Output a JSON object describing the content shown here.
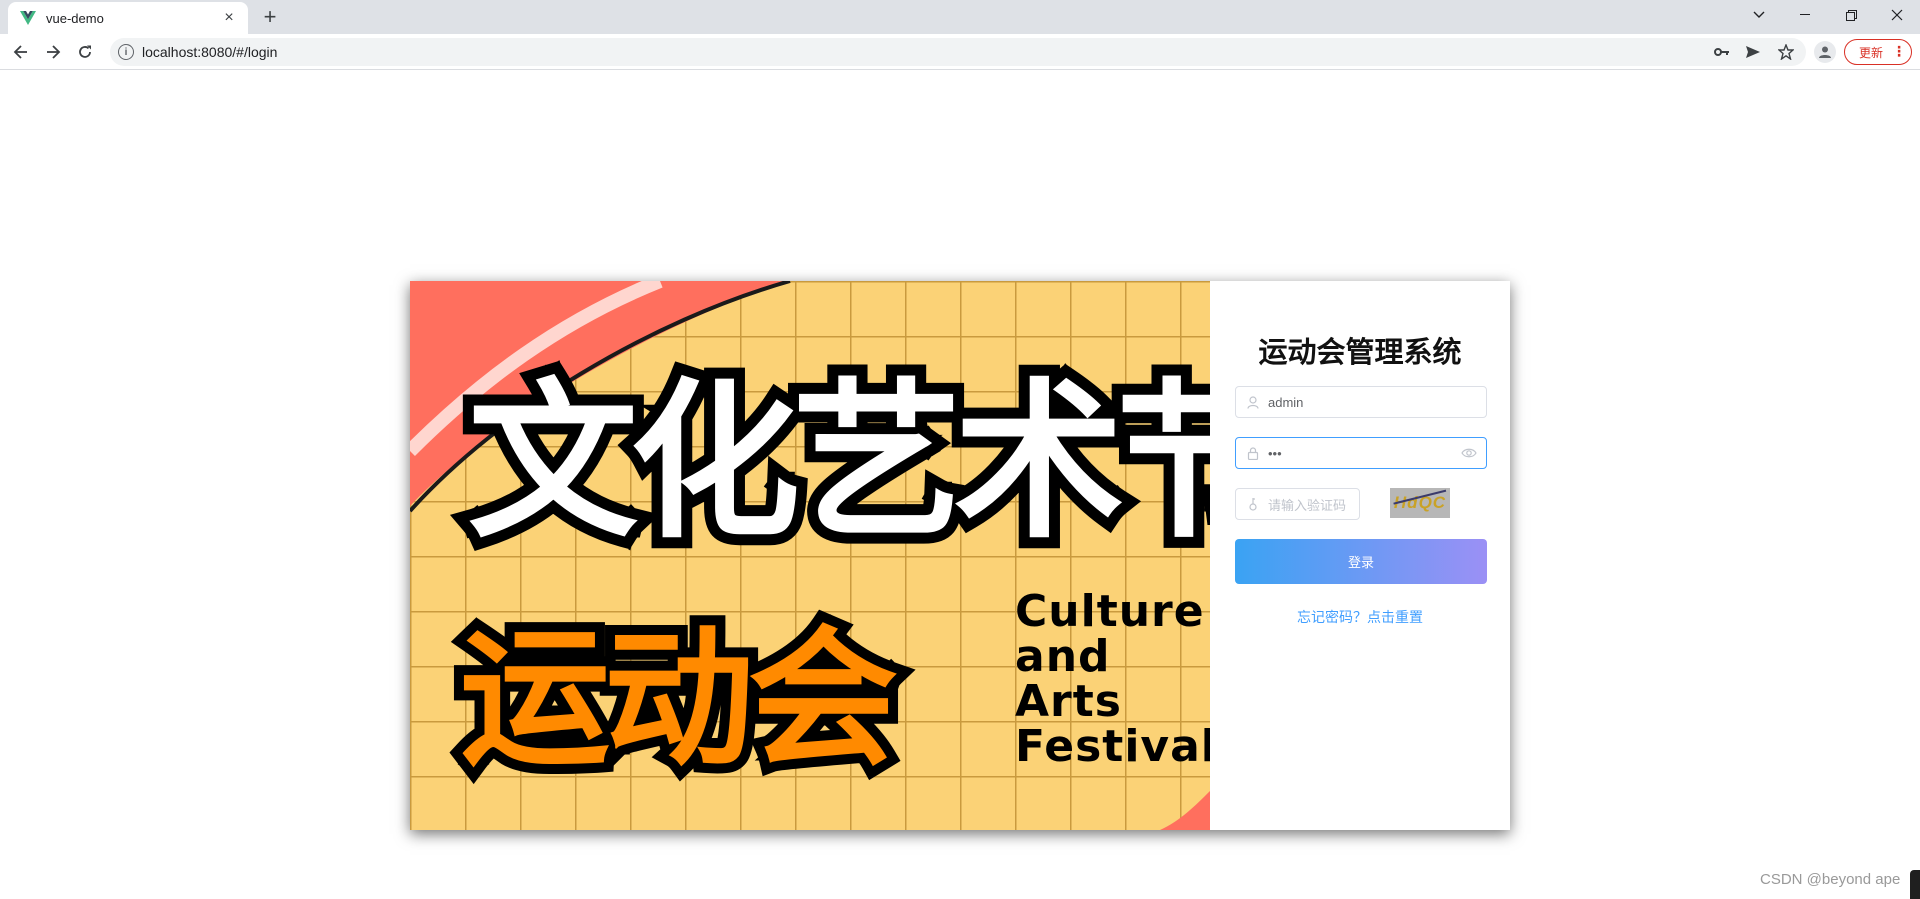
{
  "browser": {
    "tab_title": "vue-demo",
    "tab_close": "×",
    "new_tab": "+",
    "url": "localhost:8080/#/login",
    "update_label": "更新",
    "update_menu": "⋮",
    "window_controls": {
      "tab_search": "⌄",
      "minimize": "—",
      "restore": "❐",
      "close": "✕"
    }
  },
  "banner": {
    "headline": "文化艺术节",
    "subheadline": "运动会",
    "english": [
      "Culture",
      "and",
      "Arts",
      "Festival"
    ]
  },
  "login": {
    "title": "运动会管理系统",
    "username_value": "admin",
    "password_value": "•••",
    "captcha_placeholder": "请输入验证码",
    "captcha_text": "HdQC",
    "login_button": "登录",
    "forgot_link": "忘记密码？点击重置"
  },
  "watermark": "CSDN @beyond ape",
  "colors": {
    "accent": "#409eff",
    "button_start": "#3aa3f3",
    "button_end": "#9b90f5",
    "banner_bg": "#fbd276",
    "banner_orange": "#ff8a00"
  }
}
